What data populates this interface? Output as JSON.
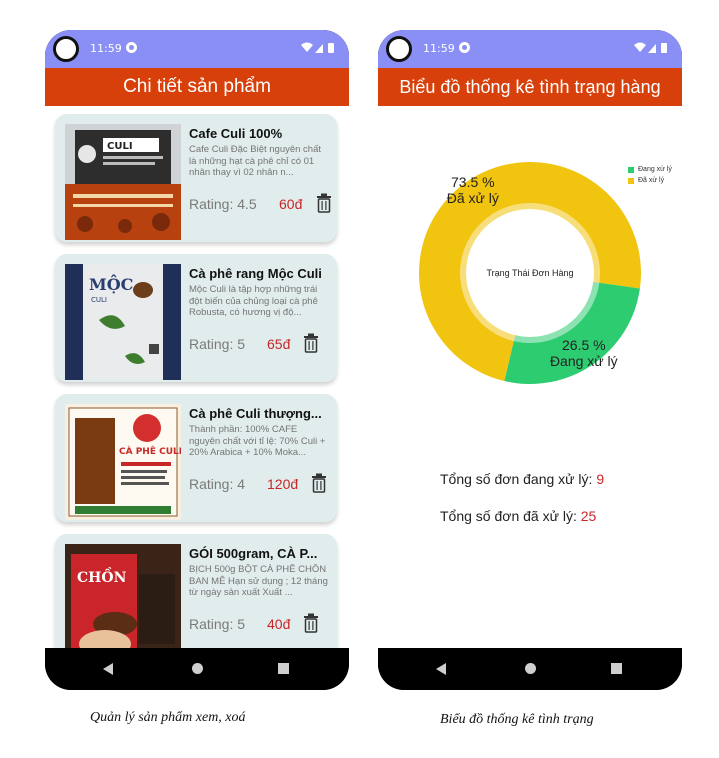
{
  "status_bar": {
    "time": "11:59"
  },
  "product_screen": {
    "title": "Chi tiết sản phẩm",
    "products": [
      {
        "name": "Cafe Culi 100%",
        "description": "Cafe Culi Đặc Biệt nguyên chất là những hạt cà phê chỉ có 01 nhân thay vì 02 nhân n...",
        "rating": "Rating: 4.5",
        "price": "60đ"
      },
      {
        "name": "Cà phê rang Mộc Culi",
        "description": "Mộc Culi là tập hợp những trái đột biến của chủng loại cà phê Robusta, có hương vị độ...",
        "rating": "Rating: 5",
        "price": "65đ"
      },
      {
        "name": "Cà phê Culi thượng...",
        "description": "Thành phần: 100% CAFE nguyên chất với tỉ lệ: 70% Culi + 20% Arabica + 10% Moka...",
        "rating": "Rating: 4",
        "price": "120đ"
      },
      {
        "name": "GÓI 500gram, CÀ P...",
        "description": "BỊCH 500g BỘT CÀ PHÊ CHỒN BAN MÊ  Hạn sử dụng ; 12 tháng từ ngày sản xuất  Xuất ...",
        "rating": "Rating: 5",
        "price": "40đ"
      }
    ],
    "caption": "Quản lý sản phẩm xem, xoá"
  },
  "chart_screen": {
    "title": "Biểu đồ thống kê tình trạng hàng",
    "center_text": "Trạng Thái Đơn Hàng",
    "stat_processing": {
      "label": "Tổng số đơn đang xử lý:",
      "value": "9"
    },
    "stat_processed": {
      "label": "Tổng số đơn đã xử lý:",
      "value": "25"
    },
    "caption": "Biểu đồ thống kê tình trạng"
  },
  "chart_data": {
    "type": "pie",
    "title": "",
    "center_label": "Trạng Thái Đơn Hàng",
    "legend_position": "top-right",
    "legend": [
      "Đang xử lý",
      "Đã xử lý"
    ],
    "slices": [
      {
        "name": "Đang xử lý",
        "value": 26.5,
        "label_percent": "26.5 %",
        "label_text": "Đang xử lý",
        "color": "#2ecc71"
      },
      {
        "name": "Đã xử lý",
        "value": 73.5,
        "label_percent": "73.5 %",
        "label_text": "Đã xử lý",
        "color": "#f1c40f"
      }
    ]
  },
  "colors": {
    "status_bar": "#8a8ff5",
    "app_bar": "#d8400b",
    "card_bg": "#e1eced",
    "price": "#c62828"
  },
  "icons": [
    "camera-cutout-icon",
    "google-icon",
    "wifi-icon",
    "signal-icon",
    "battery-icon",
    "trash-icon",
    "nav-back-icon",
    "nav-home-icon",
    "nav-recents-icon"
  ]
}
